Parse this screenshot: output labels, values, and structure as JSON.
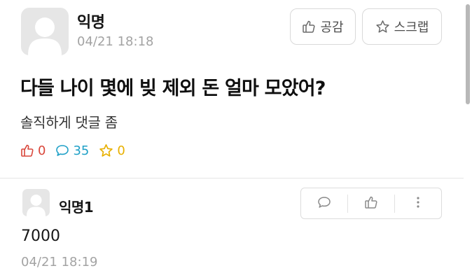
{
  "post": {
    "author": "익명",
    "timestamp": "04/21 18:18",
    "like_button": "공감",
    "scrap_button": "스크랩",
    "title": "다들 나이 몇에 빚 제외 돈 얼마 모았어?",
    "content": "솔직하게 댓글 좀",
    "stats": {
      "likes": "0",
      "comments": "35",
      "scraps": "0"
    }
  },
  "comment": {
    "author": "익명1",
    "text": "7000",
    "timestamp": "04/21 18:19"
  },
  "colors": {
    "like": "#d9463a",
    "comment": "#1fa0c7",
    "scrap": "#e8b000",
    "muted": "#a3a3a3"
  },
  "icons": [
    "avatar-icon",
    "thumbs-up-icon",
    "star-icon",
    "speech-bubble-icon",
    "more-vertical-icon"
  ]
}
